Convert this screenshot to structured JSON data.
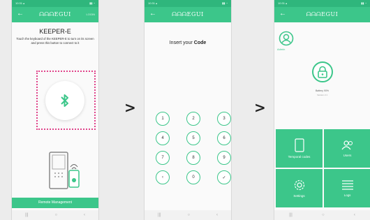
{
  "app": {
    "brand": "ᗩᗩᗩEGUI",
    "back": "←"
  },
  "screen1": {
    "status": "10:31 ▴",
    "status_right": "▮▮ ◔",
    "header_right": "LOGIN",
    "title": "KEEPER-E",
    "instructions": "Touch the keyboard of the KEEPER-E to turn on its screen and press this button to connect to it",
    "bluetooth_icon": "bluetooth-icon",
    "button": "Remote Management"
  },
  "screen2": {
    "status": "10:31 ▴",
    "status_right": "▮▮ ◔",
    "prompt_prefix": "Insert your",
    "prompt_bold": "Code",
    "keys": [
      "1",
      "2",
      "3",
      "4",
      "5",
      "6",
      "7",
      "8",
      "9",
      "‹",
      "0",
      "✓"
    ]
  },
  "screen3": {
    "status": "10:31 ▴",
    "status_right": "▮▮ ◔",
    "user_label": "Admin",
    "battery": "Battery 90%",
    "version": "Version 2.1",
    "tiles": [
      "Temporal codes",
      "Users",
      "Settings",
      "Logs"
    ]
  },
  "nav": {
    "menu": "|||",
    "home": "○",
    "back": "‹"
  },
  "arrows": [
    ">",
    ">"
  ],
  "colors": {
    "accent": "#3cc68a",
    "dotted": "#e0438a"
  }
}
